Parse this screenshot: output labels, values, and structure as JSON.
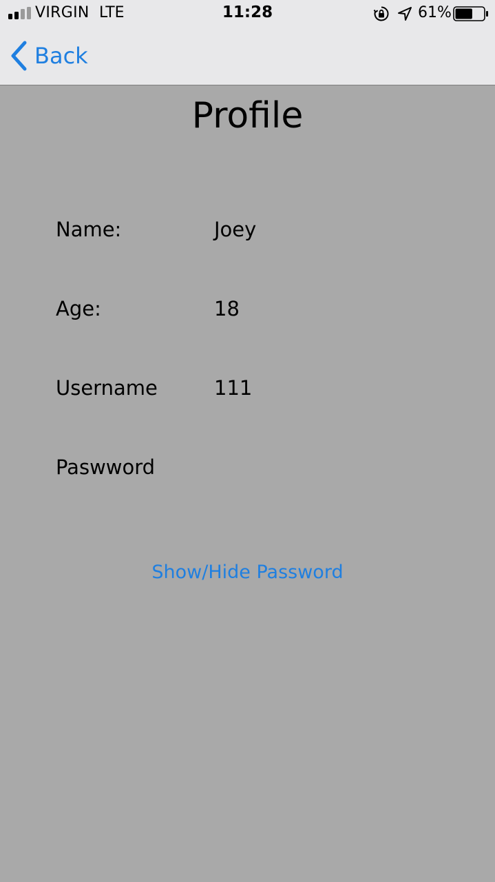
{
  "status_bar": {
    "carrier": "VIRGIN",
    "network": "LTE",
    "time": "11:28",
    "battery_percent": "61%",
    "battery_level": 0.61,
    "signal_bars_filled": 2,
    "signal_bars_total": 4,
    "icons": [
      "signal-icon",
      "orientation-lock-icon",
      "location-arrow-icon",
      "battery-icon"
    ]
  },
  "nav": {
    "back_label": "Back"
  },
  "profile": {
    "title": "Profile",
    "fields": [
      {
        "label": "Name:",
        "value": "Joey"
      },
      {
        "label": "Age:",
        "value": "18"
      },
      {
        "label": "Username",
        "value": "111"
      },
      {
        "label": "Paswword",
        "value": ""
      }
    ],
    "toggle_password_label": "Show/Hide Password"
  },
  "colors": {
    "background": "#a9a9a9",
    "nav_background": "#e8e8ea",
    "accent": "#1f7fe0",
    "text": "#000000"
  }
}
